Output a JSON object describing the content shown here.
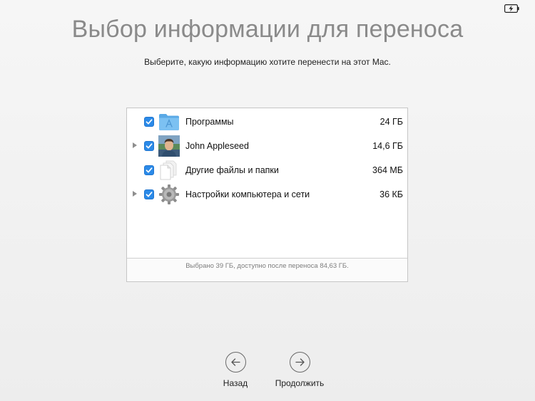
{
  "status_bar": {
    "battery_icon": "battery-charging-icon"
  },
  "header": {
    "title": "Выбор информации для переноса",
    "subtitle": "Выберите, какую информацию хотите перенести на этот Mac."
  },
  "items": [
    {
      "label": "Программы",
      "size": "24 ГБ",
      "checked": true,
      "expandable": false,
      "icon": "applications-folder-icon"
    },
    {
      "label": "John Appleseed",
      "size": "14,6 ГБ",
      "checked": true,
      "expandable": true,
      "icon": "user-avatar-icon"
    },
    {
      "label": "Другие файлы и папки",
      "size": "364 МБ",
      "checked": true,
      "expandable": false,
      "icon": "documents-icon"
    },
    {
      "label": "Настройки компьютера и сети",
      "size": "36 КБ",
      "checked": true,
      "expandable": true,
      "icon": "gear-icon"
    }
  ],
  "footer": {
    "status": "Выбрано 39 ГБ, доступно после переноса 84,63 ГБ."
  },
  "navigation": {
    "back_label": "Назад",
    "continue_label": "Продолжить"
  },
  "colors": {
    "accent": "#2b8ae8",
    "title": "#8a8a8a",
    "folder": "#6cb6ee"
  }
}
